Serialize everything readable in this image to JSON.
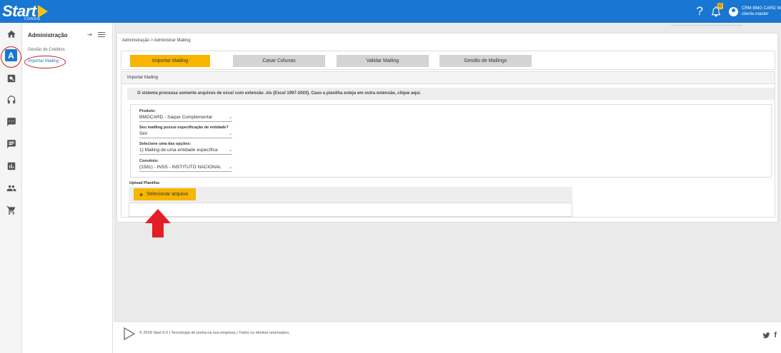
{
  "app": {
    "logo_text": "Start",
    "logo_sub": "CONSIG",
    "help_label": "?",
    "notification_count": "0",
    "user_line1": "CRM BMG CARD WS",
    "user_line2": "cliente.master"
  },
  "sidebar": {
    "title": "Administração",
    "items": [
      {
        "label": "Gestão de Créditos"
      },
      {
        "label": "Importar Mailing"
      }
    ],
    "active_letter": "A"
  },
  "breadcrumb": "Administração > Administrar Mailing",
  "tabs": [
    {
      "label": "Importar Mailing"
    },
    {
      "label": "Casar Colunas"
    },
    {
      "label": "Validar Mailing"
    },
    {
      "label": "Gestão de Mailings"
    }
  ],
  "section_title": "Importar Mailing",
  "info_text": "O sistema processa somente arquivos de excel com extensão .xls (Excel 1997-2003). Caso a planilha esteja em outra extensão, clique aqui.",
  "form": {
    "fields": [
      {
        "label": "Produto:",
        "value": "BMGCARD - Saque Complementar"
      },
      {
        "label": "Seu mailling possui especificação de entidade?",
        "value": "Sim"
      },
      {
        "label": "Selecione uma das opções:",
        "value": "1) Mailing de uma entidade específica"
      },
      {
        "label": "Convênio:",
        "value": "(1581) - INSS - INSTITUTO NACIONAL"
      }
    ]
  },
  "upload": {
    "label": "Upload Planilha:",
    "button_label": "Selecionar arquivo",
    "button_symbol": "+"
  },
  "footer": {
    "text": "© 2018 Start 6.0 | Tecnologia de ponta na sua empresa | Todos os direitos reservados."
  },
  "colors": {
    "topbar": "#1976d2",
    "accent": "#f7b500",
    "annotation_red": "#e31e24"
  }
}
